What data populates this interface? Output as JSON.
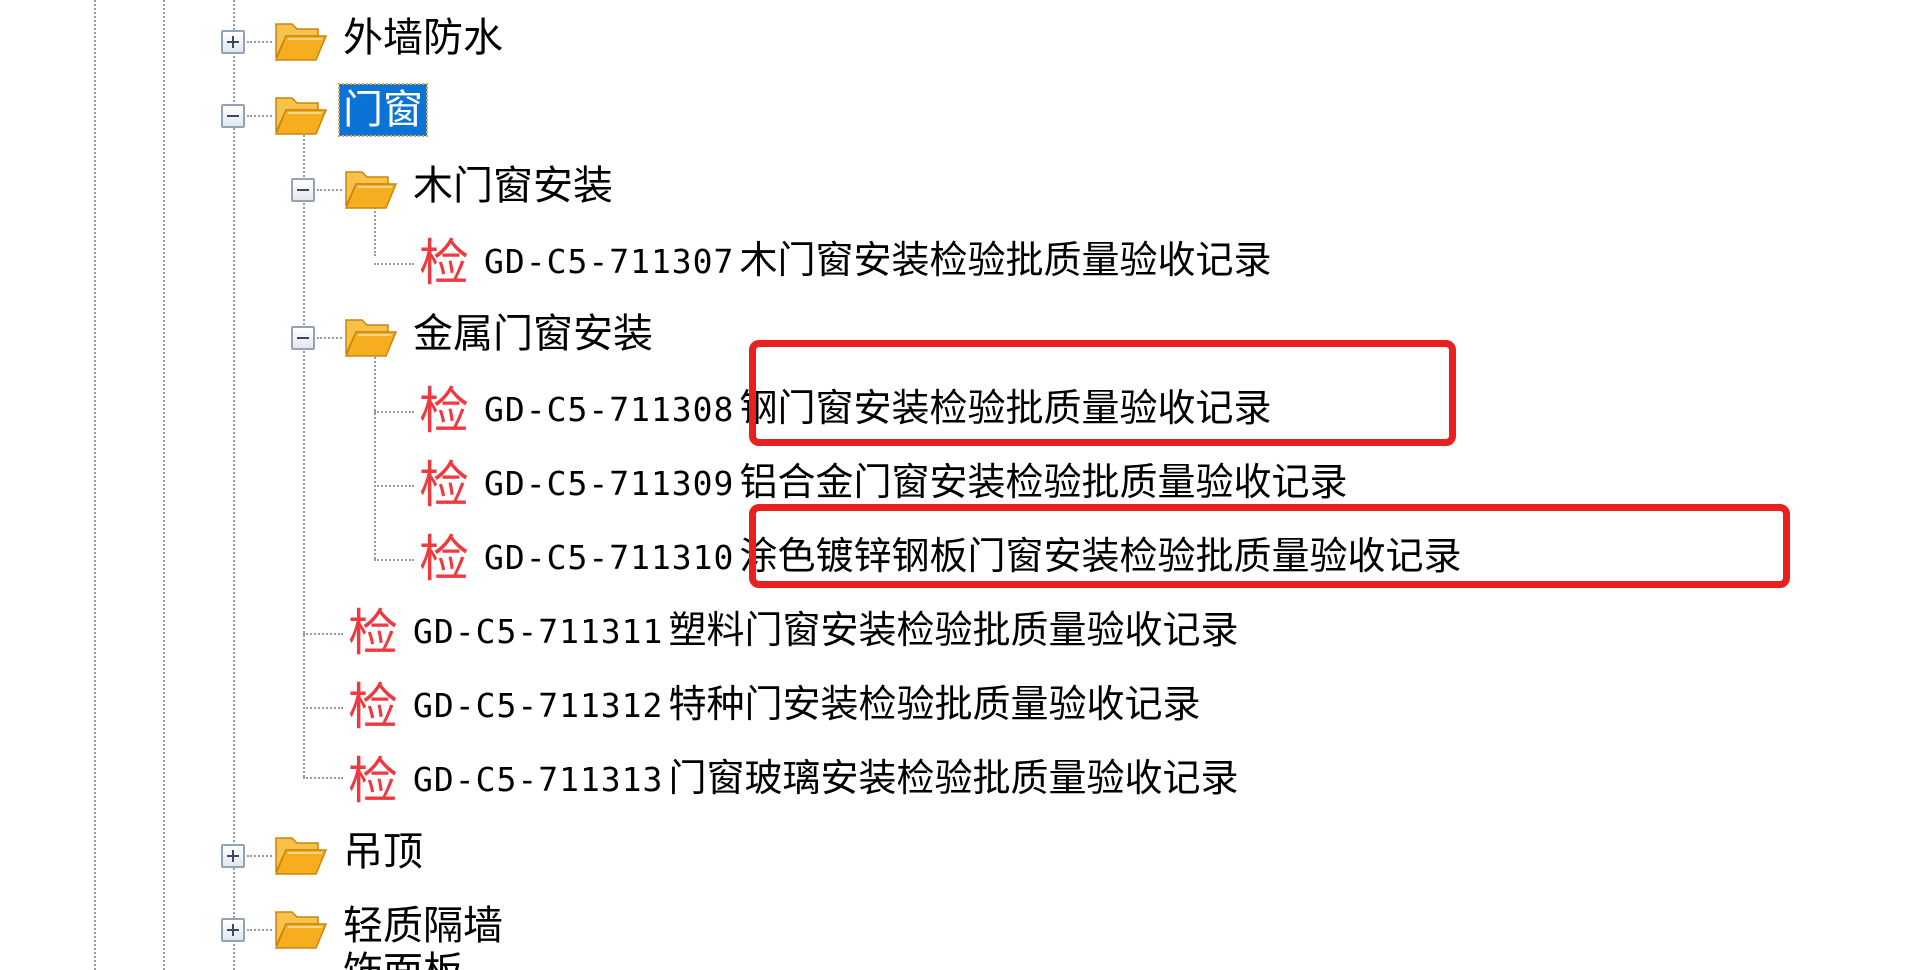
{
  "tree": {
    "folders": {
      "exterior_waterproofing": "外墙防水",
      "doors_windows": "门窗",
      "wood_doors_windows": "木门窗安装",
      "metal_doors_windows": "金属门窗安装",
      "suspended_ceiling": "吊顶",
      "lightweight_partition": "轻质隔墙",
      "partial_next": "饰面板"
    },
    "doc_icon_glyph": "检",
    "docs": [
      {
        "code": "GD-C5-711307",
        "title": "木门窗安装检验批质量验收记录"
      },
      {
        "code": "GD-C5-711308",
        "title": "钢门窗安装检验批质量验收记录"
      },
      {
        "code": "GD-C5-711309",
        "title": "铝合金门窗安装检验批质量验收记录"
      },
      {
        "code": "GD-C5-711310",
        "title": "涂色镀锌钢板门窗安装检验批质量验收记录"
      },
      {
        "code": "GD-C5-711311",
        "title": "塑料门窗安装检验批质量验收记录"
      },
      {
        "code": "GD-C5-711312",
        "title": "特种门安装检验批质量验收记录"
      },
      {
        "code": "GD-C5-711313",
        "title": "门窗玻璃安装检验批质量验收记录"
      }
    ],
    "selected_folder": "门窗"
  },
  "colors": {
    "selection_bg": "#0b72d6",
    "folder_yellow": "#f6ad1f",
    "doc_icon_red": "#f0393f",
    "annotation_red": "#e82020",
    "guide_gray": "#9a9a9a"
  }
}
